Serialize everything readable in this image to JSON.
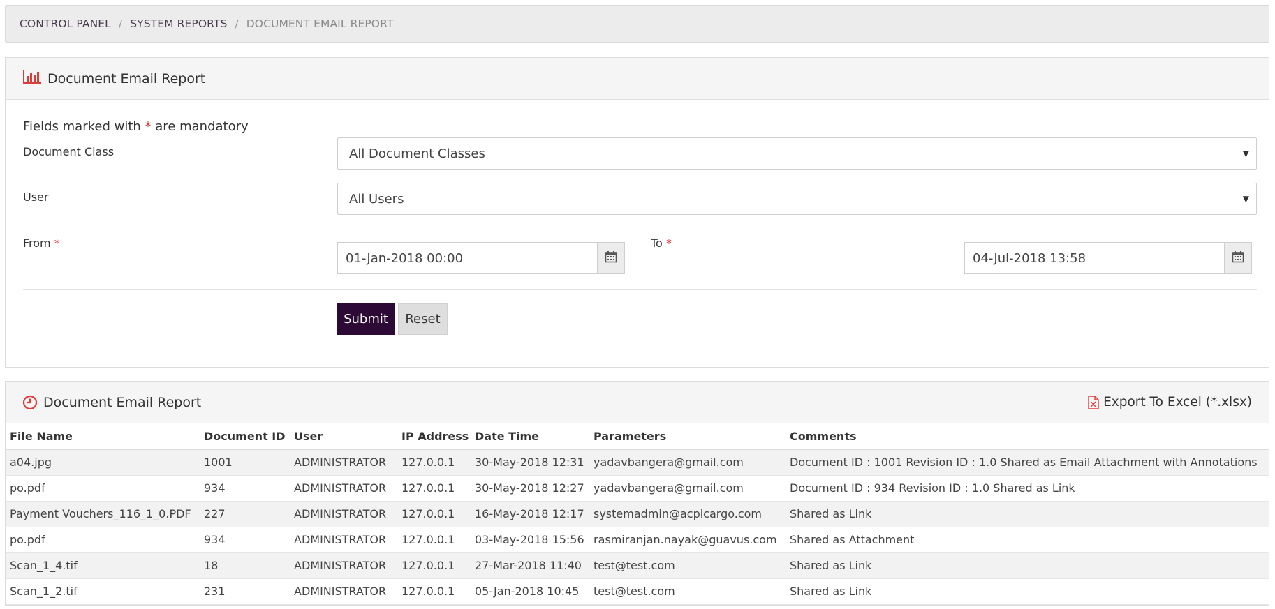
{
  "breadcrumb": {
    "items": [
      "CONTROL PANEL",
      "SYSTEM REPORTS",
      "DOCUMENT EMAIL REPORT"
    ],
    "separator": "/"
  },
  "form_panel": {
    "title": "Document Email Report",
    "icon": "bar-chart-icon",
    "mandatory_prefix": "Fields marked with",
    "mandatory_star": "*",
    "mandatory_suffix": "are mandatory",
    "document_class": {
      "label": "Document Class",
      "value": "All Document Classes"
    },
    "user": {
      "label": "User",
      "value": "All Users"
    },
    "from": {
      "label": "From",
      "value": "01-Jan-2018 00:00"
    },
    "to": {
      "label": "To",
      "value": "04-Jul-2018 13:58"
    },
    "submit_label": "Submit",
    "reset_label": "Reset"
  },
  "table_panel": {
    "title": "Document Email Report",
    "icon": "clock-icon",
    "export_label": "Export To Excel (*.xlsx)",
    "export_icon": "excel-file-icon",
    "columns": [
      "File Name",
      "Document ID",
      "User",
      "IP Address",
      "Date Time",
      "Parameters",
      "Comments"
    ],
    "rows": [
      [
        "a04.jpg",
        "1001",
        "ADMINISTRATOR",
        "127.0.0.1",
        "30-May-2018 12:31",
        "yadavbangera@gmail.com",
        "Document ID : 1001 Revision ID : 1.0 Shared as Email Attachment with Annotations"
      ],
      [
        "po.pdf",
        "934",
        "ADMINISTRATOR",
        "127.0.0.1",
        "30-May-2018 12:27",
        "yadavbangera@gmail.com",
        "Document ID : 934 Revision ID : 1.0 Shared as Link"
      ],
      [
        "Payment Vouchers_116_1_0.PDF",
        "227",
        "ADMINISTRATOR",
        "127.0.0.1",
        "16-May-2018 12:17",
        "systemadmin@acplcargo.com",
        "Shared as Link"
      ],
      [
        "po.pdf",
        "934",
        "ADMINISTRATOR",
        "127.0.0.1",
        "03-May-2018 15:56",
        "rasmiranjan.nayak@guavus.com",
        "Shared as Attachment"
      ],
      [
        "Scan_1_4.tif",
        "18",
        "ADMINISTRATOR",
        "127.0.0.1",
        "27-Mar-2018 11:40",
        "test@test.com",
        "Shared as Link"
      ],
      [
        "Scan_1_2.tif",
        "231",
        "ADMINISTRATOR",
        "127.0.0.1",
        "05-Jan-2018 10:45",
        "test@test.com",
        "Shared as Link"
      ]
    ]
  },
  "colors": {
    "accent_red": "#e03b3b",
    "submit_bg": "#2d0a35",
    "breadcrumb_text": "#4a3a4f"
  }
}
